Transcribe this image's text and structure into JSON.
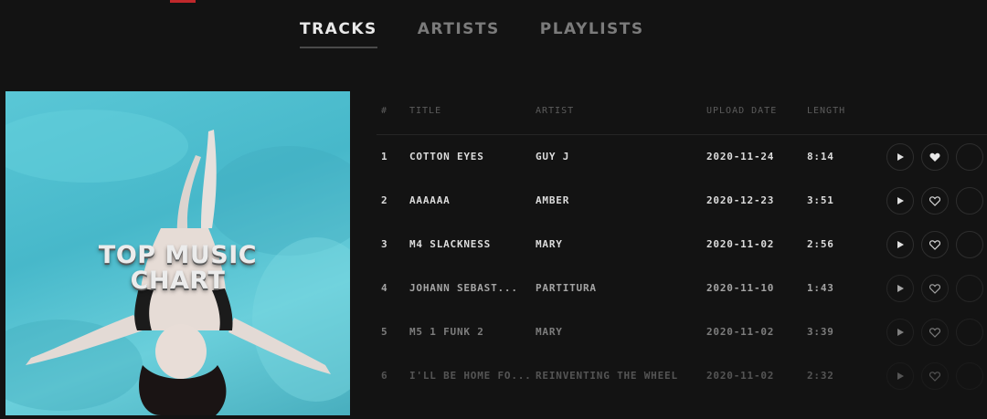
{
  "tabs": [
    {
      "label": "TRACKS",
      "active": true
    },
    {
      "label": "ARTISTS",
      "active": false
    },
    {
      "label": "PLAYLISTS",
      "active": false
    }
  ],
  "cover": {
    "title_line1": "TOP MUSIC",
    "title_line2": "CHART"
  },
  "table": {
    "headers": {
      "num": "#",
      "title": "TITLE",
      "artist": "ARTIST",
      "upload_date": "UPLOAD DATE",
      "length": "LENGTH"
    },
    "rows": [
      {
        "num": "1",
        "title": "COTTON EYES",
        "artist": "GUY J",
        "date": "2020-11-24",
        "length": "8:14",
        "liked": true
      },
      {
        "num": "2",
        "title": "AAAAAA",
        "artist": "AMBER",
        "date": "2020-12-23",
        "length": "3:51",
        "liked": false
      },
      {
        "num": "3",
        "title": "M4 SLACKNESS",
        "artist": "MARY",
        "date": "2020-11-02",
        "length": "2:56",
        "liked": false
      },
      {
        "num": "4",
        "title": "JOHANN SEBAST...",
        "artist": "PARTITURA",
        "date": "2020-11-10",
        "length": "1:43",
        "liked": false
      },
      {
        "num": "5",
        "title": "M5 1 FUNK 2",
        "artist": "MARY",
        "date": "2020-11-02",
        "length": "3:39",
        "liked": false
      },
      {
        "num": "6",
        "title": "I'LL BE HOME FO...",
        "artist": "REINVENTING THE WHEEL",
        "date": "2020-11-02",
        "length": "2:32",
        "liked": false
      }
    ]
  },
  "icons": {
    "play": "play-icon",
    "heart": "heart-icon",
    "more": "more-icon"
  },
  "colors": {
    "background": "#131313",
    "accent": "#c0282b",
    "cover_water": "#5ac7d6"
  }
}
